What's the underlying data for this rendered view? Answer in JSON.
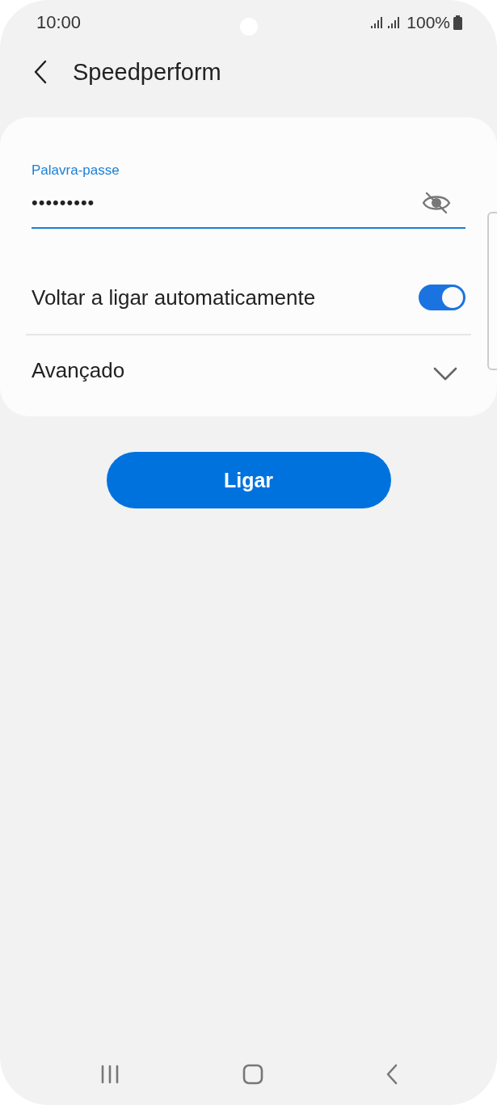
{
  "status_bar": {
    "time": "10:00",
    "battery": "100%"
  },
  "header": {
    "title": "Speedperform"
  },
  "password": {
    "label": "Palavra-passe",
    "value": "•••••••••",
    "visible": false
  },
  "settings": [
    {
      "kind": "toggle",
      "label": "Voltar a ligar automaticamente",
      "on": true
    },
    {
      "kind": "expander",
      "label": "Avançado",
      "expanded": false
    }
  ],
  "connect_button": {
    "label": "Ligar"
  }
}
